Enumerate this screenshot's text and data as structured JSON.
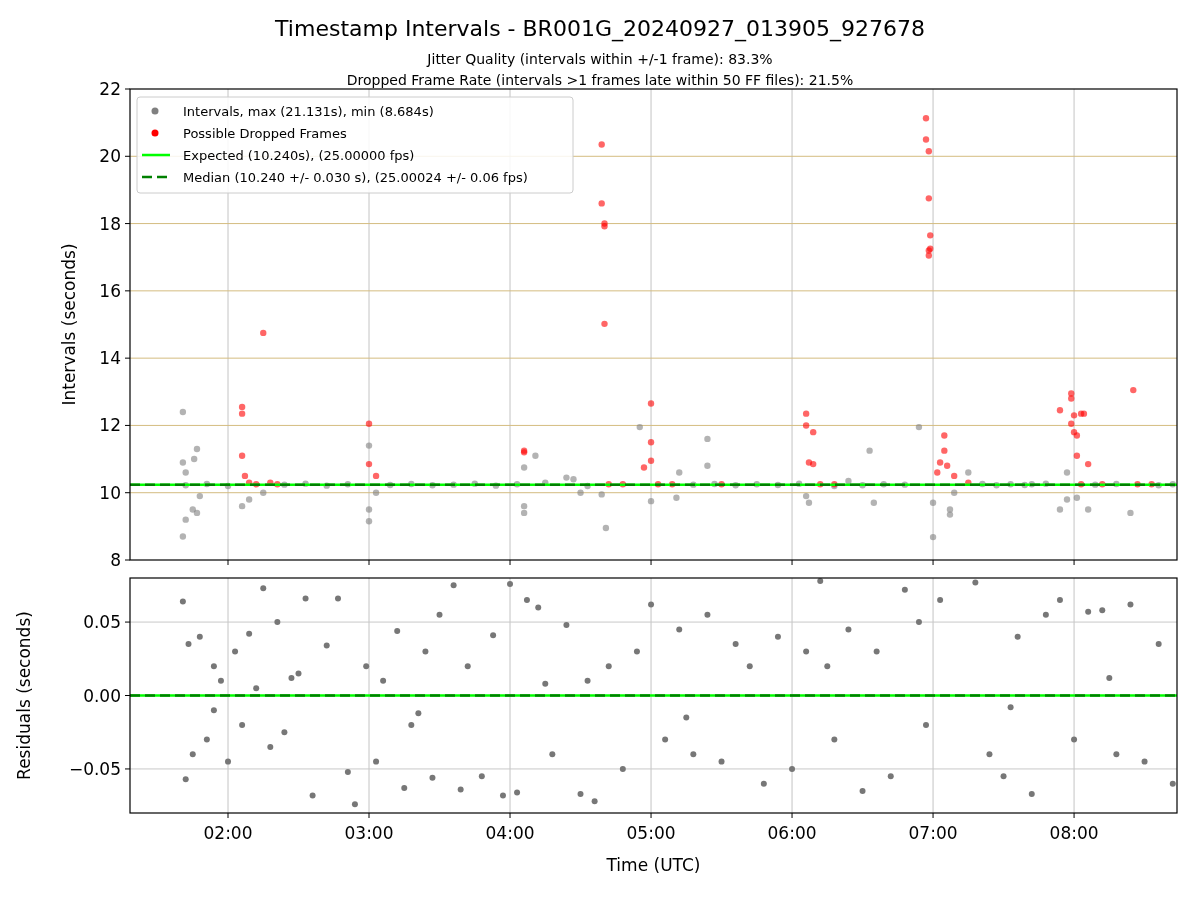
{
  "figure": {
    "title": "Timestamp Intervals - BR001G_20240927_013905_927678",
    "subtitles": [
      "Jitter Quality (intervals within +/-1 frame): 83.3%",
      "Dropped Frame Rate (intervals >1 frames late within 50 FF files): 21.5%"
    ]
  },
  "intervals_panel": {
    "chart_data": {
      "type": "scatter",
      "ylabel": "Intervals (seconds)",
      "grid": true,
      "xlim": [
        1.305,
        8.73
      ],
      "ylim": [
        8,
        22
      ],
      "yticks": [
        {
          "value": 8,
          "label": "8"
        },
        {
          "value": 10,
          "label": "10"
        },
        {
          "value": 12,
          "label": "12"
        },
        {
          "value": 14,
          "label": "14"
        },
        {
          "value": 16,
          "label": "16"
        },
        {
          "value": 18,
          "label": "18"
        },
        {
          "value": 20,
          "label": "20"
        },
        {
          "value": 22,
          "label": "22"
        }
      ],
      "series": [
        {
          "name": "Intervals, max (21.131s), min (8.684s)",
          "color": "#808080",
          "x": [
            1.68,
            1.68,
            1.7,
            1.7,
            1.68,
            1.75,
            1.78,
            1.78,
            1.76,
            1.8,
            2.1,
            2.15,
            2.25,
            3.0,
            3.0,
            3.0,
            3.05,
            4.1,
            4.1,
            4.1,
            4.18,
            4.45,
            4.5,
            4.65,
            4.68,
            4.92,
            5.0,
            5.2,
            5.18,
            5.4,
            5.4,
            6.1,
            6.12,
            6.3,
            6.55,
            6.58,
            6.9,
            7.0,
            7.0,
            7.12,
            7.12,
            7.25,
            7.15,
            7.7,
            7.9,
            7.95,
            8.1,
            8.4,
            7.95,
            8.02,
            1.7,
            1.85,
            2.0,
            2.4,
            2.55,
            2.7,
            2.85,
            3.15,
            3.3,
            3.45,
            3.6,
            3.75,
            3.9,
            4.05,
            4.25,
            4.4,
            4.55,
            5.3,
            5.45,
            5.6,
            5.75,
            5.9,
            6.05,
            6.4,
            6.5,
            6.65,
            6.8,
            7.35,
            7.45,
            7.55,
            7.65,
            7.8,
            8.15,
            8.3,
            8.6,
            8.7
          ],
          "values": [
            12.4,
            10.9,
            10.6,
            9.2,
            8.7,
            9.5,
            11.3,
            9.4,
            11.0,
            9.9,
            9.6,
            9.8,
            10.0,
            11.4,
            9.5,
            9.15,
            10.0,
            10.75,
            9.6,
            9.4,
            11.1,
            10.4,
            10.0,
            9.95,
            8.95,
            11.95,
            9.75,
            10.6,
            9.85,
            11.6,
            10.8,
            9.9,
            9.7,
            10.2,
            11.25,
            9.7,
            11.95,
            8.68,
            9.7,
            9.5,
            9.35,
            10.6,
            10.0,
            10.25,
            9.5,
            10.6,
            9.5,
            9.4,
            9.8,
            9.85,
            10.22,
            10.26,
            10.2,
            10.24,
            10.27,
            10.21,
            10.25,
            10.23,
            10.26,
            10.22,
            10.24,
            10.27,
            10.21,
            10.25,
            10.3,
            10.45,
            10.2,
            10.24,
            10.26,
            10.22,
            10.25,
            10.23,
            10.27,
            10.35,
            10.22,
            10.25,
            10.24,
            10.26,
            10.22,
            10.25,
            10.23,
            10.27,
            10.24,
            10.26,
            10.22,
            10.25
          ]
        },
        {
          "name": "Possible Dropped Frames",
          "color": "#ff0000",
          "x": [
            2.1,
            2.1,
            2.1,
            2.12,
            2.25,
            2.15,
            2.2,
            2.3,
            2.35,
            3.0,
            3.0,
            3.05,
            4.1,
            4.1,
            4.65,
            4.65,
            4.67,
            4.67,
            4.67,
            4.7,
            4.8,
            4.95,
            5.0,
            5.0,
            5.0,
            5.05,
            5.15,
            5.5,
            6.1,
            6.1,
            6.12,
            6.15,
            6.15,
            6.2,
            6.3,
            6.95,
            6.95,
            6.97,
            6.97,
            6.98,
            6.98,
            6.97,
            6.97,
            7.03,
            7.05,
            7.08,
            7.08,
            7.1,
            7.15,
            7.25,
            7.9,
            7.98,
            7.98,
            8.0,
            7.98,
            8.0,
            8.02,
            8.05,
            8.07,
            8.02,
            8.1,
            8.05,
            8.2,
            8.42,
            8.45,
            8.55
          ],
          "values": [
            12.55,
            12.35,
            11.1,
            10.5,
            14.75,
            10.3,
            10.25,
            10.3,
            10.25,
            12.05,
            10.85,
            10.5,
            11.25,
            11.2,
            20.35,
            18.6,
            18.0,
            17.92,
            15.02,
            10.25,
            10.25,
            10.75,
            12.65,
            11.5,
            10.95,
            10.25,
            10.25,
            10.25,
            12.35,
            12.0,
            10.9,
            11.8,
            10.85,
            10.25,
            10.25,
            21.13,
            20.5,
            20.15,
            18.75,
            17.65,
            17.25,
            17.2,
            17.05,
            10.6,
            10.9,
            11.7,
            11.25,
            10.8,
            10.5,
            10.3,
            12.45,
            12.95,
            12.8,
            12.3,
            12.05,
            11.8,
            11.7,
            12.35,
            12.35,
            11.1,
            10.85,
            10.25,
            10.25,
            13.05,
            10.25,
            10.25
          ]
        }
      ],
      "ref_lines": [
        {
          "axis": "y",
          "value": 10.24,
          "label": "Expected (10.240s), (25.00000 fps)",
          "color": "#00ff00"
        },
        {
          "axis": "y",
          "value": 10.24,
          "label": "Median (10.240 +/- 0.030 s), (25.00024 +/- 0.06 fps)",
          "color": "#008000"
        }
      ],
      "legend": true
    }
  },
  "residuals_panel": {
    "chart_data": {
      "type": "scatter",
      "xlabel": "Time (UTC)",
      "ylabel": "Residuals (seconds)",
      "grid": true,
      "xlim": [
        1.305,
        8.73
      ],
      "ylim": [
        -0.08,
        0.08
      ],
      "xticks": [
        {
          "value": 2,
          "label": "02:00"
        },
        {
          "value": 3,
          "label": "03:00"
        },
        {
          "value": 4,
          "label": "04:00"
        },
        {
          "value": 5,
          "label": "05:00"
        },
        {
          "value": 6,
          "label": "06:00"
        },
        {
          "value": 7,
          "label": "07:00"
        },
        {
          "value": 8,
          "label": "08:00"
        }
      ],
      "yticks": [
        {
          "value": 0.05,
          "label": "0.05"
        },
        {
          "value": 0,
          "label": "0.00"
        },
        {
          "value": -0.05,
          "label": "−0.05"
        }
      ],
      "series": [
        {
          "color": "#777777",
          "x": [
            1.68,
            1.7,
            1.72,
            1.75,
            1.8,
            1.85,
            1.9,
            1.95,
            2.0,
            2.05,
            2.1,
            2.15,
            2.2,
            2.25,
            2.3,
            2.35,
            2.4,
            2.45,
            2.55,
            2.6,
            2.7,
            2.78,
            2.85,
            2.9,
            2.98,
            3.05,
            3.1,
            3.2,
            3.25,
            3.3,
            3.4,
            3.45,
            3.5,
            3.6,
            3.65,
            3.7,
            3.8,
            3.88,
            3.95,
            4.0,
            4.05,
            4.12,
            4.2,
            4.3,
            4.4,
            4.5,
            4.55,
            4.6,
            4.7,
            4.8,
            4.9,
            5.0,
            5.1,
            5.2,
            5.3,
            5.4,
            5.5,
            5.6,
            5.7,
            5.8,
            5.9,
            6.0,
            6.1,
            6.2,
            6.3,
            6.4,
            6.5,
            6.6,
            6.7,
            6.8,
            6.9,
            6.95,
            7.05,
            7.3,
            7.4,
            7.5,
            7.6,
            7.7,
            7.8,
            7.9,
            8.0,
            8.1,
            8.2,
            8.3,
            8.4,
            8.5,
            8.6,
            8.7,
            1.9,
            2.5,
            3.35,
            4.25,
            5.25,
            6.25,
            7.55,
            8.25
          ],
          "values": [
            0.064,
            -0.057,
            0.035,
            -0.04,
            0.04,
            -0.03,
            0.02,
            0.01,
            -0.045,
            0.03,
            -0.02,
            0.042,
            0.005,
            0.073,
            -0.035,
            0.05,
            -0.025,
            0.012,
            0.066,
            -0.068,
            0.034,
            0.066,
            -0.052,
            -0.074,
            0.02,
            -0.045,
            0.01,
            0.044,
            -0.063,
            -0.02,
            0.03,
            -0.056,
            0.055,
            0.075,
            -0.064,
            0.02,
            -0.055,
            0.041,
            -0.068,
            0.076,
            -0.066,
            0.065,
            0.06,
            -0.04,
            0.048,
            -0.067,
            0.01,
            -0.072,
            0.02,
            -0.05,
            0.03,
            0.062,
            -0.03,
            0.045,
            -0.04,
            0.055,
            -0.045,
            0.035,
            0.02,
            -0.06,
            0.04,
            -0.05,
            0.03,
            0.078,
            -0.03,
            0.045,
            -0.065,
            0.03,
            -0.055,
            0.072,
            0.05,
            -0.02,
            0.065,
            0.077,
            -0.04,
            -0.055,
            0.04,
            -0.067,
            0.055,
            0.065,
            -0.03,
            0.057,
            0.058,
            -0.04,
            0.062,
            -0.045,
            0.035,
            -0.06,
            -0.01,
            0.015,
            -0.012,
            0.008,
            -0.015,
            0.02,
            -0.008,
            0.012
          ]
        }
      ],
      "ref_lines": [
        {
          "axis": "y",
          "value": 0,
          "color": "#00ff00"
        },
        {
          "axis": "y",
          "value": 0,
          "color": "#008000"
        }
      ]
    }
  }
}
